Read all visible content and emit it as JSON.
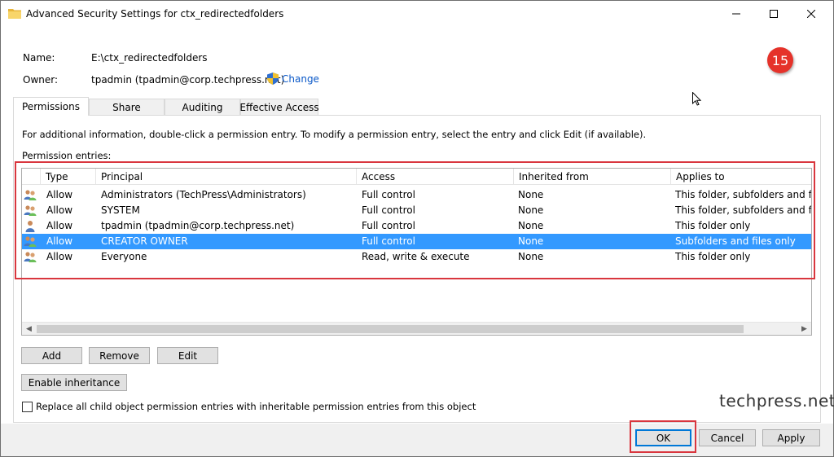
{
  "window": {
    "title": "Advanced Security Settings for ctx_redirectedfolders",
    "minimize_glyph": "—",
    "maximize_glyph": "☐",
    "close_glyph": "✕"
  },
  "info": {
    "name_label": "Name:",
    "name_value": "E:\\ctx_redirectedfolders",
    "owner_label": "Owner:",
    "owner_value": "tpadmin (tpadmin@corp.techpress.net)",
    "change_link": "Change"
  },
  "badge": {
    "number": "15"
  },
  "tabs": [
    {
      "label": "Permissions",
      "active": true
    },
    {
      "label": "Share",
      "active": false
    },
    {
      "label": "Auditing",
      "active": false
    },
    {
      "label": "Effective Access",
      "active": false
    }
  ],
  "permissions": {
    "hint": "For additional information, double-click a permission entry. To modify a permission entry, select the entry and click Edit (if available).",
    "entries_label": "Permission entries:",
    "columns": [
      "Type",
      "Principal",
      "Access",
      "Inherited from",
      "Applies to"
    ],
    "rows": [
      {
        "icon": "group-users-icon",
        "type": "Allow",
        "principal": "Administrators (TechPress\\Administrators)",
        "access": "Full control",
        "inherited": "None",
        "applies": "This folder, subfolders and files",
        "selected": false
      },
      {
        "icon": "group-users-icon",
        "type": "Allow",
        "principal": "SYSTEM",
        "access": "Full control",
        "inherited": "None",
        "applies": "This folder, subfolders and files",
        "selected": false
      },
      {
        "icon": "user-icon",
        "type": "Allow",
        "principal": "tpadmin (tpadmin@corp.techpress.net)",
        "access": "Full control",
        "inherited": "None",
        "applies": "This folder only",
        "selected": false
      },
      {
        "icon": "group-users-icon",
        "type": "Allow",
        "principal": "CREATOR OWNER",
        "access": "Full control",
        "inherited": "None",
        "applies": "Subfolders and files only",
        "selected": true
      },
      {
        "icon": "group-users-icon",
        "type": "Allow",
        "principal": "Everyone",
        "access": "Read, write & execute",
        "inherited": "None",
        "applies": "This folder only",
        "selected": false
      }
    ]
  },
  "buttons": {
    "add": "Add",
    "remove": "Remove",
    "edit": "Edit",
    "enable_inheritance": "Enable inheritance",
    "ok": "OK",
    "cancel": "Cancel",
    "apply": "Apply"
  },
  "replace_checkbox": {
    "label": "Replace all child object permission entries with inheritable permission entries from this object",
    "checked": false
  },
  "watermark": "techpress.net",
  "colors": {
    "selection": "#3399ff",
    "annotation_red": "#d9363e",
    "badge_red": "#e5322a",
    "link_blue": "#0a58c8"
  }
}
